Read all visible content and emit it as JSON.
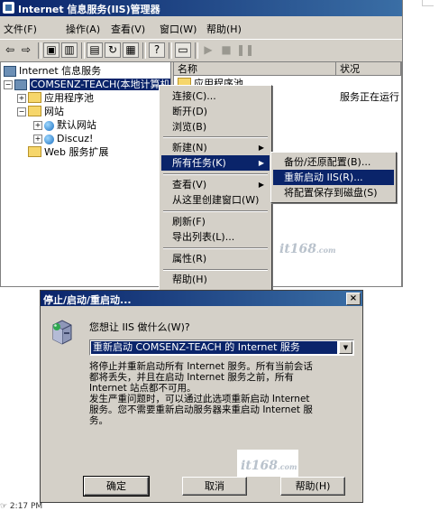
{
  "iis": {
    "title": "Internet 信息服务(IIS)管理器",
    "menu": [
      "文件(F)",
      "操作(A)",
      "查看(V)",
      "窗口(W)",
      "帮助(H)"
    ],
    "tree": {
      "root": "Internet 信息服务",
      "server": "COMSENZ-TEACH(本地计算机)",
      "apppools": "应用程序池",
      "sites": "网站",
      "default_site": "默认网站",
      "discuz": "Discuz!",
      "webext": "Web 服务扩展"
    },
    "list": {
      "col_name": "名称",
      "col_status": "状况",
      "row1_name": "应用程序池",
      "row2_status": "服务正在运行"
    }
  },
  "context_menu": {
    "items": [
      "连接(C)...",
      "断开(D)",
      "浏览(B)",
      "新建(N)",
      "所有任务(K)",
      "查看(V)",
      "从这里创建窗口(W)",
      "刷新(F)",
      "导出列表(L)...",
      "属性(R)",
      "帮助(H)"
    ],
    "selected_index": 4
  },
  "submenu": {
    "items": [
      "备份/还原配置(B)...",
      "重新启动 IIS(R)...",
      "将配置保存到磁盘(S)"
    ],
    "selected_index": 1
  },
  "dialog": {
    "title": "停止/启动/重启动...",
    "close": "×",
    "question": "您想让 IIS 做什么(W)?",
    "selected_option": "重新启动 COMSENZ-TEACH 的 Internet 服务",
    "description": "将停止并重新启动所有 Internet 服务。所有当前会话\n都将丢失，并且在启动 Internet 服务之前，所有\nInternet 站点都不可用。\n发生严重问题时，可以通过此选项重新启动 Internet\n服务。您不需要重新启动服务器来重启动 Internet 服\n务。",
    "ok": "确定",
    "cancel": "取消",
    "help": "帮助(H)"
  },
  "watermark": "it168",
  "footer": "☞ 2:17 PM"
}
